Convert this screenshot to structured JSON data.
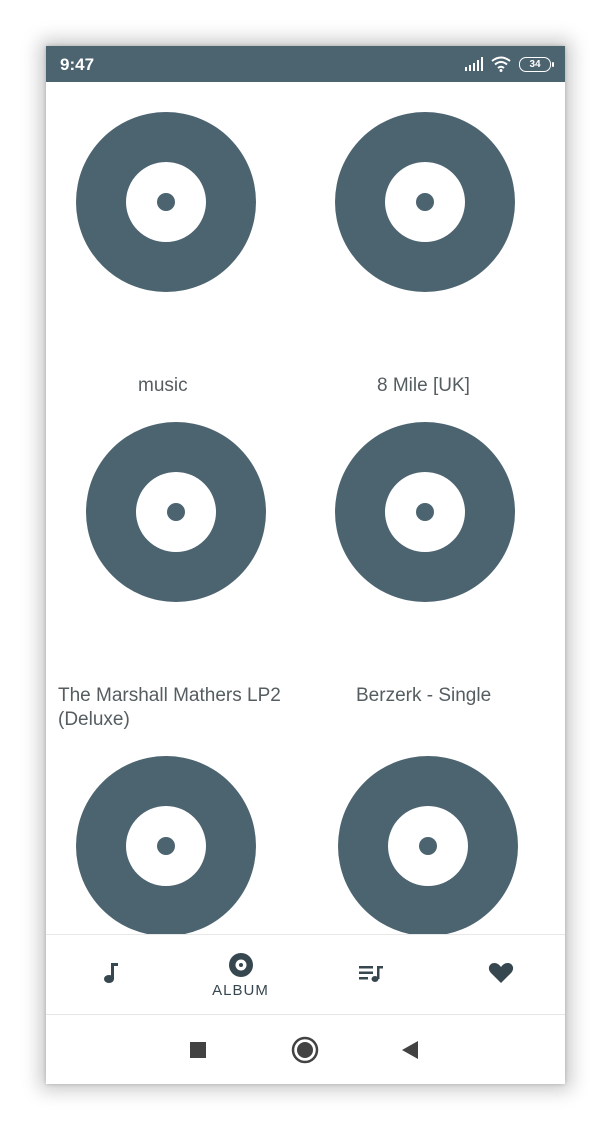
{
  "status_bar": {
    "time": "9:47",
    "battery": "34",
    "icons": [
      "signal-icon",
      "wifi-icon",
      "battery-icon"
    ]
  },
  "albums": [
    {
      "title": "music"
    },
    {
      "title": "8 Mile [UK]"
    },
    {
      "title": "The Marshall Mathers LP2 (Deluxe)"
    },
    {
      "title": "Berzerk - Single"
    },
    {
      "title": ""
    },
    {
      "title": ""
    }
  ],
  "bottom_nav": {
    "items": [
      {
        "icon": "music-note-icon",
        "label": ""
      },
      {
        "icon": "album-disc-icon",
        "label": "ALBUM"
      },
      {
        "icon": "playlist-icon",
        "label": ""
      },
      {
        "icon": "heart-icon",
        "label": ""
      }
    ],
    "active": "ALBUM"
  },
  "system_nav": {
    "icons": [
      "recents-square-icon",
      "home-circle-icon",
      "back-triangle-icon"
    ]
  },
  "colors": {
    "accent": "#4c6370",
    "text": "#555d61",
    "background": "#ffffff"
  }
}
